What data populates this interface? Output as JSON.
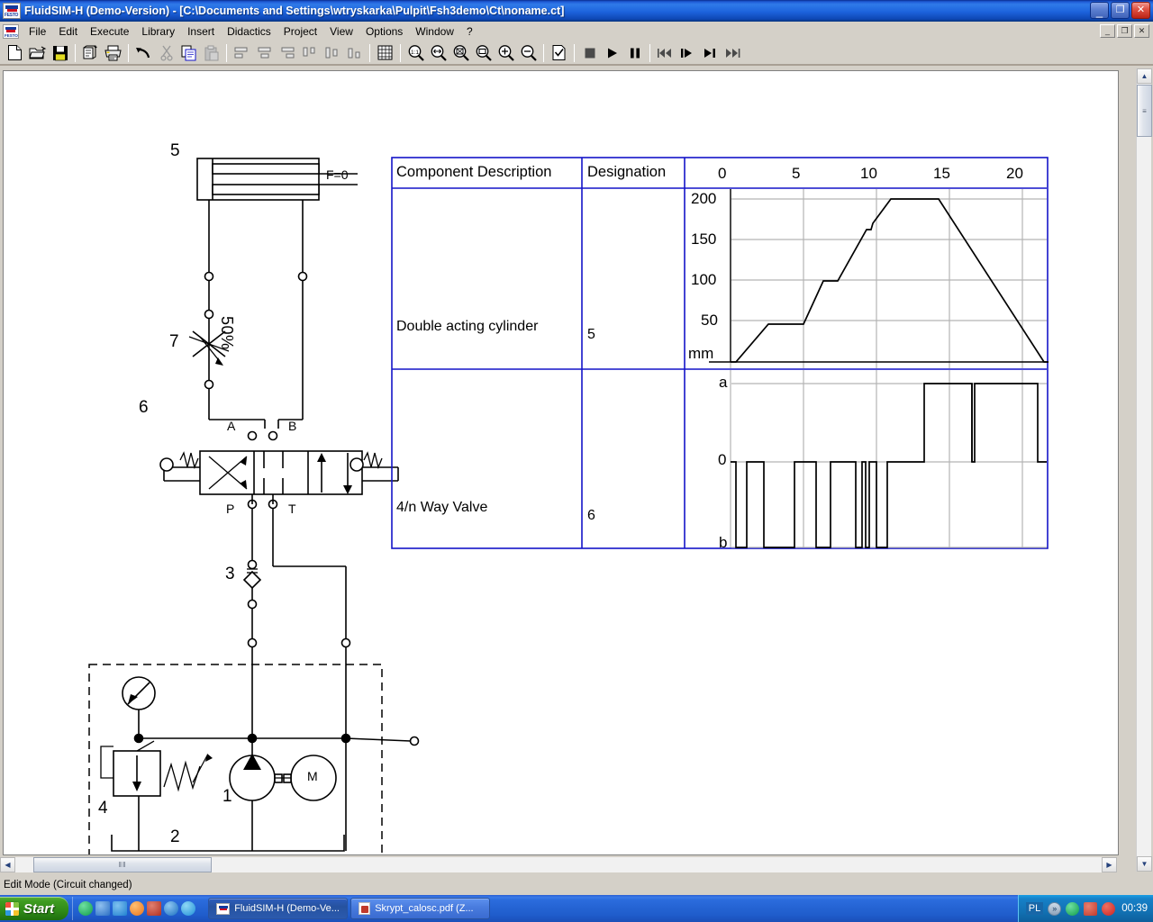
{
  "window": {
    "title": "FluidSIM-H (Demo-Version) - [C:\\Documents and Settings\\wtryskarka\\Pulpit\\Fsh3demo\\Ct\\noname.ct]",
    "logo_text": "FESTO",
    "minimize_glyph": "_",
    "restore_glyph": "❐",
    "close_glyph": "✕",
    "mdi_min": "_",
    "mdi_restore": "❐",
    "mdi_close": "✕"
  },
  "menu": {
    "items": [
      {
        "label": "File"
      },
      {
        "label": "Edit"
      },
      {
        "label": "Execute"
      },
      {
        "label": "Library"
      },
      {
        "label": "Insert"
      },
      {
        "label": "Didactics"
      },
      {
        "label": "Project"
      },
      {
        "label": "View"
      },
      {
        "label": "Options"
      },
      {
        "label": "Window"
      },
      {
        "label": "?"
      }
    ]
  },
  "toolbar": {
    "groups": [
      [
        "new-document-icon",
        "open-folder-icon",
        "save-disk-icon"
      ],
      [
        "print-preview-icon",
        "print-icon"
      ],
      [
        "undo-arrow-icon",
        "cut-scissors-icon",
        "copy-icon",
        "paste-icon"
      ],
      [
        "align-left-icon",
        "align-center-icon",
        "align-right-icon",
        "distribute-top-icon",
        "distribute-middle-icon",
        "distribute-bottom-icon"
      ],
      [
        "grid-icon"
      ],
      [
        "zoom-actual-size-icon",
        "zoom-fit-width-icon",
        "zoom-fit-page-icon",
        "zoom-region-icon",
        "zoom-in-icon",
        "zoom-out-icon"
      ],
      [
        "check-circuit-icon"
      ],
      [
        "stop-icon",
        "play-icon",
        "pause-icon"
      ],
      [
        "rewind-to-start-icon",
        "step-forward-icon",
        "forward-to-end-icon",
        "fast-forward-icon"
      ]
    ],
    "zoom_actual_label": "1:1"
  },
  "circuit": {
    "labels": {
      "cylinder_number": "5",
      "cylinder_force": "F=0",
      "throttle_number": "7",
      "throttle_value": "50%",
      "port_a": "A",
      "port_b": "B",
      "valve_number": "6",
      "valve_port_p": "P",
      "valve_port_t": "T",
      "check_valve_number": "3",
      "relief_valve_number": "4",
      "pump_number": "1",
      "tank_number": "2",
      "motor_letter": "M"
    }
  },
  "table": {
    "headers": [
      "Component Description",
      "Designation"
    ],
    "rows": [
      {
        "description": "Double acting cylinder",
        "designation": "5"
      },
      {
        "description": "4/n Way Valve",
        "designation": "6"
      }
    ]
  },
  "chart_data": [
    {
      "type": "line",
      "title": "Double acting cylinder",
      "designation": "5",
      "xlabel": "",
      "ylabel": "mm",
      "unit_label": "mm",
      "xticks": [
        0,
        5,
        10,
        15,
        20
      ],
      "xlim": [
        -0.6,
        21.8
      ],
      "yticks": [
        50,
        100,
        150,
        200
      ],
      "ytick_labels": [
        "50",
        "100",
        "150",
        "200"
      ],
      "ylim": [
        0,
        215
      ],
      "grid": true,
      "points": [
        [
          0.0,
          0
        ],
        [
          0.35,
          0
        ],
        [
          2.6,
          46
        ],
        [
          5.0,
          46
        ],
        [
          6.35,
          100
        ],
        [
          7.35,
          100
        ],
        [
          9.3,
          162
        ],
        [
          9.6,
          162
        ],
        [
          9.75,
          170
        ],
        [
          11.0,
          200
        ],
        [
          14.1,
          200
        ],
        [
          21.5,
          0
        ],
        [
          21.9,
          0
        ]
      ]
    },
    {
      "type": "step",
      "title": "4/n Way Valve",
      "designation": "6",
      "ylabel": "",
      "ytick_labels": [
        "a",
        "0",
        "b"
      ],
      "yticks": [
        "a",
        "0",
        "b"
      ],
      "xticks": [
        0,
        5,
        10,
        15,
        20
      ],
      "xlim": [
        -0.6,
        21.8
      ],
      "grid": true,
      "segments": [
        {
          "from": 0.0,
          "to": 0.35,
          "state": "0"
        },
        {
          "from": 0.35,
          "to": 0.75,
          "state": "b"
        },
        {
          "from": 0.75,
          "to": 2.3,
          "state": "0"
        },
        {
          "from": 2.3,
          "to": 4.4,
          "state": "b"
        },
        {
          "from": 4.4,
          "to": 5.9,
          "state": "0"
        },
        {
          "from": 5.9,
          "to": 6.9,
          "state": "b"
        },
        {
          "from": 6.9,
          "to": 8.6,
          "state": "0"
        },
        {
          "from": 8.6,
          "to": 9.0,
          "state": "b"
        },
        {
          "from": 9.0,
          "to": 9.25,
          "state": "0"
        },
        {
          "from": 9.25,
          "to": 9.45,
          "state": "b"
        },
        {
          "from": 9.45,
          "to": 9.95,
          "state": "0"
        },
        {
          "from": 9.95,
          "to": 11.8,
          "state": "b"
        },
        {
          "from": 11.8,
          "to": 13.3,
          "state": "0"
        },
        {
          "from": 13.3,
          "to": 21.0,
          "state": "a"
        },
        {
          "from": 21.0,
          "to": 21.9,
          "state": "0"
        }
      ],
      "marker_lines": [
        16.6
      ]
    }
  ],
  "scrollbars": {
    "v_up": "▲",
    "v_down": "▼",
    "v_grip": "≡",
    "h_left": "◀",
    "h_right": "▶",
    "h_grip": "‖‖"
  },
  "status": {
    "text": "Edit Mode (Circuit changed)"
  },
  "taskbar": {
    "start_label": "Start",
    "quicklaunch": [
      {
        "name": "opera-icon",
        "color": "#0f9c4a"
      },
      {
        "name": "image-viewer-icon",
        "color": "#2b6fc4"
      },
      {
        "name": "gadu-gadu-icon",
        "color": "#1f7fd0"
      },
      {
        "name": "firefox-icon",
        "color": "#e8721c"
      },
      {
        "name": "emule-icon",
        "color": "#b03020"
      },
      {
        "name": "internet-explorer-icon",
        "color": "#1a6fc0"
      },
      {
        "name": "media-player-icon",
        "color": "#1f8fd8"
      }
    ],
    "tasks": [
      {
        "label": "FluidSIM-H (Demo-Ve...",
        "icon": "festo-icon",
        "active": true
      },
      {
        "label": "Skrypt_calosc.pdf (Z...",
        "icon": "acrobat-icon",
        "active": false
      }
    ],
    "tray": {
      "language": "PL",
      "chevron": "»",
      "icons": [
        {
          "name": "opera-tray-icon",
          "color": "#0f9c4a"
        },
        {
          "name": "acrobat-tray-icon",
          "color": "#c0392b"
        },
        {
          "name": "security-alert-icon",
          "color": "#cc2222"
        }
      ],
      "clock": "00:39"
    }
  },
  "colors": {
    "table_border": "#1414c8",
    "grid_line": "#b4b4b4",
    "curve": "#000000",
    "titlebar_blue": "#1f5bd6"
  }
}
